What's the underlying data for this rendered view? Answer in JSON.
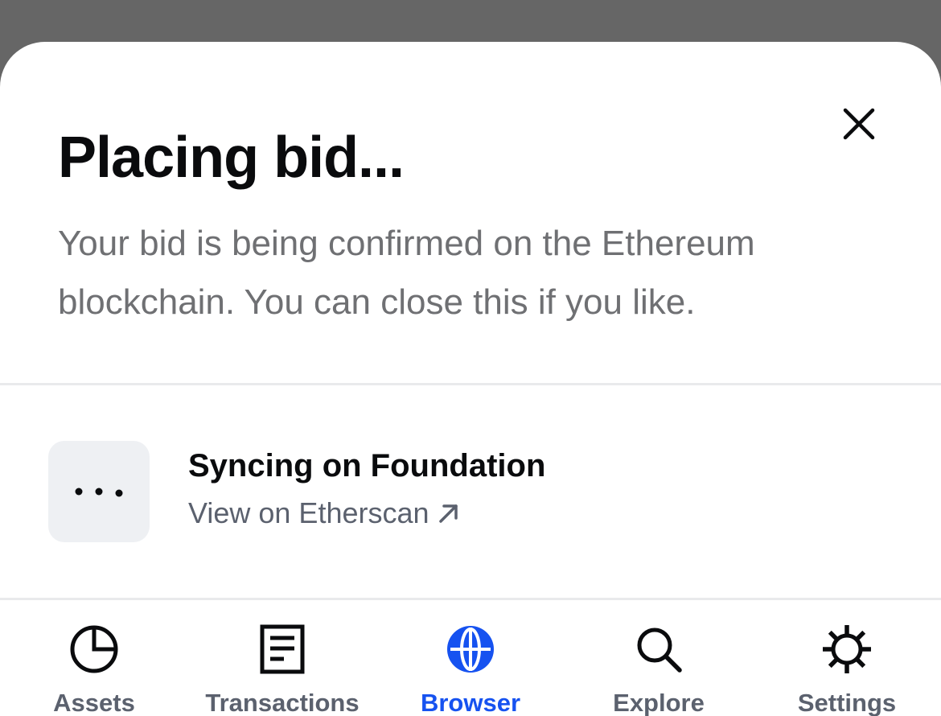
{
  "sheet": {
    "title": "Placing bid...",
    "subtitle": "Your bid is being confirmed on the Ethereum blockchain. You can close this if you like.",
    "close_icon": "close-icon"
  },
  "status": {
    "icon": "ellipsis-icon",
    "title": "Syncing on Foundation",
    "link_label": "View on Etherscan",
    "link_icon": "arrow-up-right-icon"
  },
  "tabbar": {
    "tabs": [
      {
        "label": "Assets",
        "icon": "pie-chart-icon",
        "active": false
      },
      {
        "label": "Transactions",
        "icon": "document-icon",
        "active": false
      },
      {
        "label": "Browser",
        "icon": "globe-icon",
        "active": true
      },
      {
        "label": "Explore",
        "icon": "search-icon",
        "active": false
      },
      {
        "label": "Settings",
        "icon": "gear-icon",
        "active": false
      }
    ]
  },
  "colors": {
    "backdrop": "#666666",
    "sheet_background": "#ffffff",
    "primary_text": "#0a0b0d",
    "secondary_text": "#6f7073",
    "accent": "#1652f0",
    "tab_inactive": "#5b616e"
  }
}
